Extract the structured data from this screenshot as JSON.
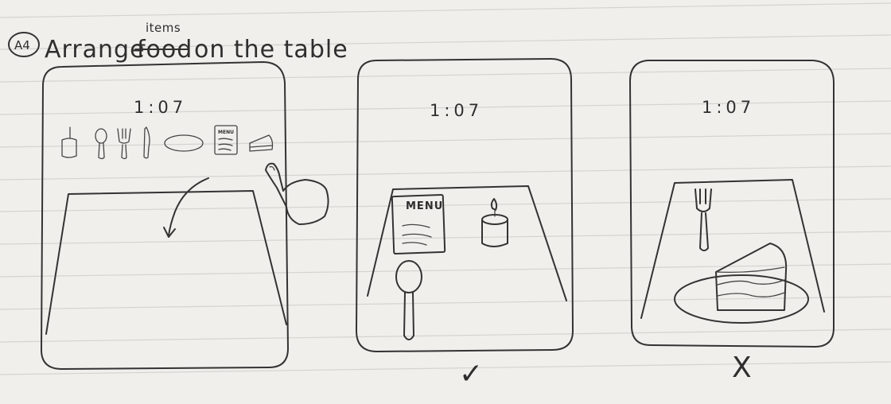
{
  "annotation": {
    "badge": "A4",
    "title_prefix": "Arrange",
    "struck_word": "food",
    "inserted_word": "items",
    "title_suffix": "on the table"
  },
  "screens": [
    {
      "time": "1:07",
      "toolbar_items": [
        "candle-icon",
        "spoon-icon",
        "fork-icon",
        "knife-icon",
        "plate-icon",
        "menu-card-icon",
        "cake-slice-icon"
      ],
      "menu_card_label": "MENU"
    },
    {
      "time": "1:07",
      "menu_label": "MENU",
      "verdict": "✓"
    },
    {
      "time": "1:07",
      "verdict": "X"
    }
  ]
}
